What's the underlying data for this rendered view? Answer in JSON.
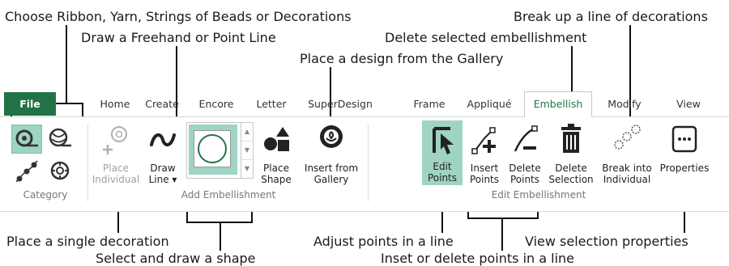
{
  "callouts": {
    "choose": "Choose Ribbon, Yarn, Strings of Beads or Decorations",
    "draw_line": "Draw a Freehand or Point Line",
    "place_gallery": "Place a design from the Gallery",
    "delete_selected": "Delete selected embellishment",
    "break_up": "Break up a line of decorations",
    "place_single": "Place a single decoration",
    "select_draw_shape": "Select and draw a shape",
    "adjust_points": "Adjust points in a line",
    "inset_delete": "Inset or delete points in a line",
    "view_props": "View selection properties"
  },
  "tabs": [
    "File",
    "Home",
    "Create",
    "Encore",
    "Letter",
    "SuperDesign",
    "Frame",
    "Appliqué",
    "Embellish",
    "Modify",
    "View"
  ],
  "active_tab": "Embellish",
  "groups": {
    "category": "Category",
    "add": "Add Embellishment",
    "edit": "Edit Embellishment"
  },
  "buttons": {
    "place_individual": [
      "Place",
      "Individual"
    ],
    "draw_line": [
      "Draw",
      "Line ▾"
    ],
    "place_shape": [
      "Place",
      "Shape"
    ],
    "insert_gallery": [
      "Insert from",
      "Gallery"
    ],
    "edit_points": [
      "Edit",
      "Points"
    ],
    "insert_points": [
      "Insert",
      "Points"
    ],
    "delete_points": [
      "Delete",
      "Points"
    ],
    "delete_selection": [
      "Delete",
      "Selection"
    ],
    "break_into": [
      "Break into",
      "Individual"
    ],
    "properties": [
      "Properties"
    ]
  },
  "colors": {
    "accent": "#217346",
    "selected_bg": "#9fd3c3",
    "icon_dark": "#333333",
    "disabled": "#a0a0a0"
  }
}
